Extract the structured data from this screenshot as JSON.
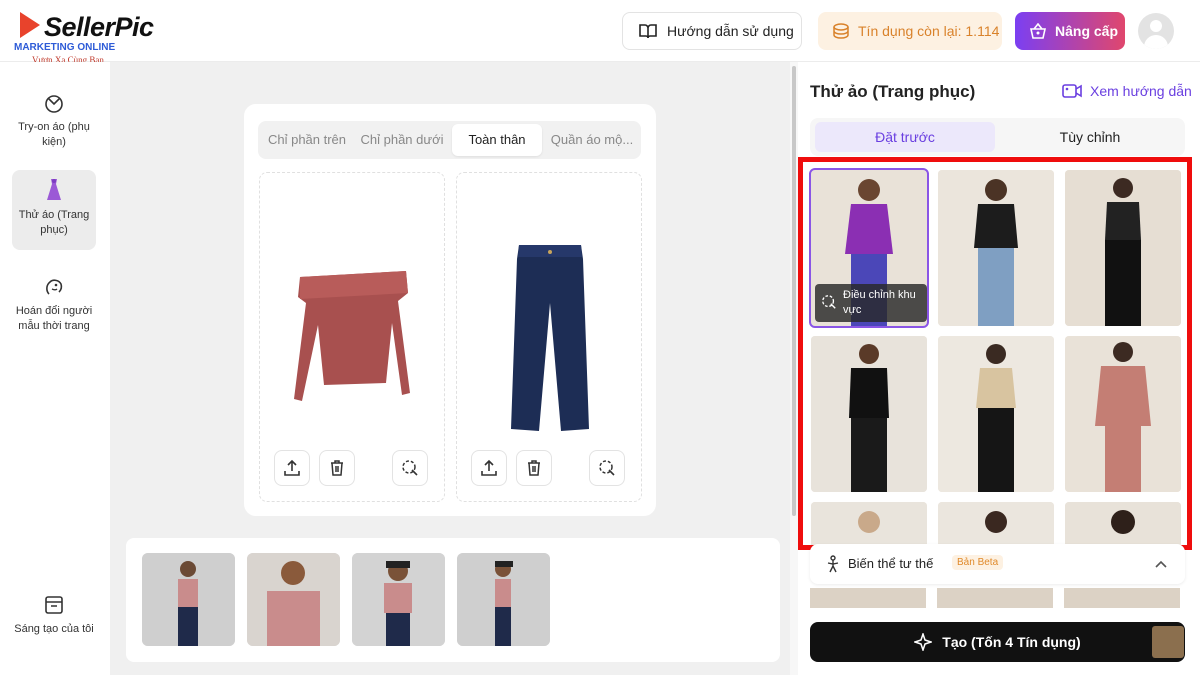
{
  "header": {
    "logo_brand": "SellerPic",
    "logo_tagline": "MARKETING ONLINE",
    "logo_slogan": "Vươn Xa Cùng Bạn",
    "guide_label": "Hướng dẫn sử dụng",
    "credits_label": "Tín dụng còn lại: 1.114",
    "upgrade_label": "Nâng cấp"
  },
  "sidebar": {
    "items": [
      {
        "label": "Try-on áo (phụ kiện)",
        "icon": "accessory-icon"
      },
      {
        "label": "Thử áo (Trang phục)",
        "icon": "dress-icon"
      },
      {
        "label": "Hoán đổi người mẫu thời trang",
        "icon": "face-swap-icon"
      },
      {
        "label": "Sáng tạo của tôi",
        "icon": "archive-icon"
      }
    ]
  },
  "workspace": {
    "tabs": [
      "Chỉ phần trên",
      "Chỉ phần dưới",
      "Toàn thân",
      "Quần áo mộ..."
    ],
    "active_tab": "Toàn thân"
  },
  "right_panel": {
    "title": "Thử ảo (Trang phục)",
    "guide_link": "Xem hướng dẫn",
    "segments": [
      "Đặt trước",
      "Tùy chỉnh"
    ],
    "active_segment": "Đặt trước",
    "adjust_label": "Điều chỉnh khu vực",
    "pose_label": "Biến thể tư thế",
    "beta_label": "Bản Beta",
    "create_label": "Tạo (Tốn 4 Tín dụng)"
  },
  "colors": {
    "accent": "#6a3fe0",
    "highlight_box": "#ef0d0d",
    "credits_text": "#d9822b"
  }
}
